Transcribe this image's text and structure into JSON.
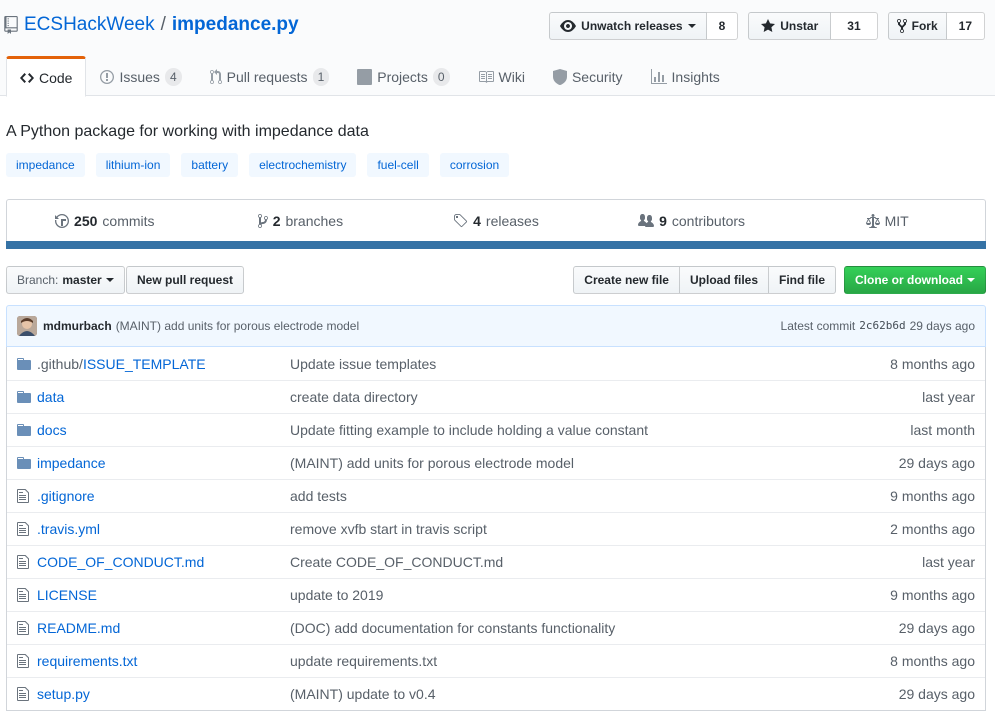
{
  "repo": {
    "owner": "ECSHackWeek",
    "separator": "/",
    "name": "impedance.py"
  },
  "actions": {
    "watch": {
      "label": "Unwatch releases",
      "count": "8"
    },
    "star": {
      "label": "Unstar",
      "count": "31"
    },
    "fork": {
      "label": "Fork",
      "count": "17"
    }
  },
  "tabs": [
    {
      "label": "Code",
      "counter": "",
      "icon": "code-icon",
      "selected": true
    },
    {
      "label": "Issues",
      "counter": "4",
      "icon": "issue-icon"
    },
    {
      "label": "Pull requests",
      "counter": "1",
      "icon": "pull-request-icon"
    },
    {
      "label": "Projects",
      "counter": "0",
      "icon": "project-icon"
    },
    {
      "label": "Wiki",
      "counter": "",
      "icon": "book-icon"
    },
    {
      "label": "Security",
      "counter": "",
      "icon": "shield-icon"
    },
    {
      "label": "Insights",
      "counter": "",
      "icon": "graph-icon"
    }
  ],
  "description": "A Python package for working with impedance data",
  "topics": [
    "impedance",
    "lithium-ion",
    "battery",
    "electrochemistry",
    "fuel-cell",
    "corrosion"
  ],
  "summary": {
    "commits": {
      "count": "250",
      "label": "commits"
    },
    "branches": {
      "count": "2",
      "label": "branches"
    },
    "releases": {
      "count": "4",
      "label": "releases"
    },
    "contributors": {
      "count": "9",
      "label": "contributors"
    },
    "license": {
      "label": "MIT"
    }
  },
  "language_color": "#3572a5",
  "filenav": {
    "branch_label": "Branch:",
    "branch": "master",
    "new_pr": "New pull request",
    "create_file": "Create new file",
    "upload_files": "Upload files",
    "find_file": "Find file",
    "clone": "Clone or download"
  },
  "latest_commit": {
    "author": "mdmurbach",
    "message": "(MAINT) add units for porous electrode model",
    "label": "Latest commit",
    "sha": "2c62b6d",
    "age": "29 days ago"
  },
  "files": [
    {
      "type": "dir",
      "prefix": ".github/",
      "name": "ISSUE_TEMPLATE",
      "message": "Update issue templates",
      "age": "8 months ago"
    },
    {
      "type": "dir",
      "prefix": "",
      "name": "data",
      "message": "create data directory",
      "age": "last year"
    },
    {
      "type": "dir",
      "prefix": "",
      "name": "docs",
      "message": "Update fitting example to include holding a value constant",
      "age": "last month"
    },
    {
      "type": "dir",
      "prefix": "",
      "name": "impedance",
      "message": "(MAINT) add units for porous electrode model",
      "age": "29 days ago"
    },
    {
      "type": "file",
      "prefix": "",
      "name": ".gitignore",
      "message": "add tests",
      "age": "9 months ago"
    },
    {
      "type": "file",
      "prefix": "",
      "name": ".travis.yml",
      "message": "remove xvfb start in travis script",
      "age": "2 months ago"
    },
    {
      "type": "file",
      "prefix": "",
      "name": "CODE_OF_CONDUCT.md",
      "message": "Create CODE_OF_CONDUCT.md",
      "age": "last year"
    },
    {
      "type": "file",
      "prefix": "",
      "name": "LICENSE",
      "message": "update to 2019",
      "age": "9 months ago"
    },
    {
      "type": "file",
      "prefix": "",
      "name": "README.md",
      "message": "(DOC) add documentation for constants functionality",
      "age": "29 days ago"
    },
    {
      "type": "file",
      "prefix": "",
      "name": "requirements.txt",
      "message": "update requirements.txt",
      "age": "8 months ago"
    },
    {
      "type": "file",
      "prefix": "",
      "name": "setup.py",
      "message": "(MAINT) update to v0.4",
      "age": "29 days ago"
    }
  ]
}
